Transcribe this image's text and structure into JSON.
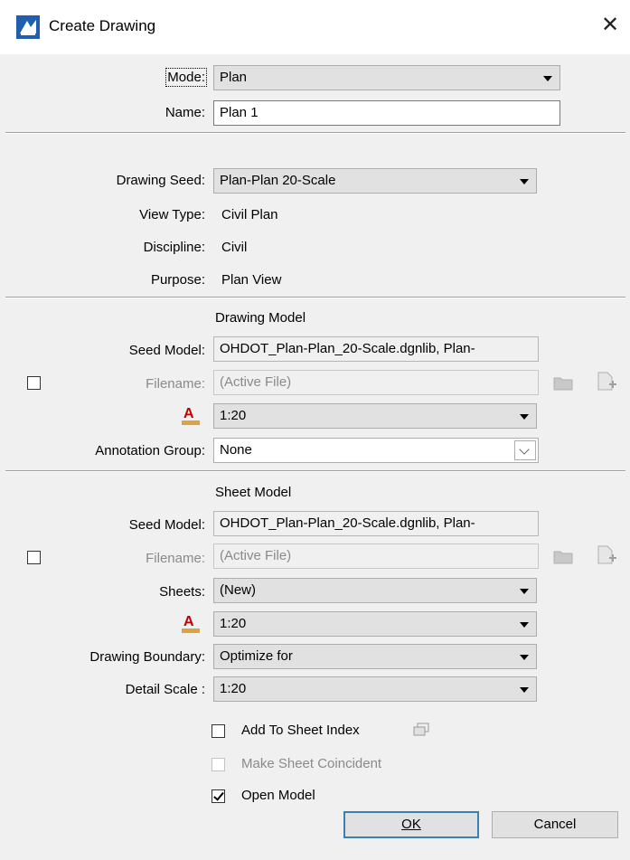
{
  "window": {
    "title": "Create Drawing",
    "close_glyph": "✕",
    "title_icon": "drawing-icon"
  },
  "mode": {
    "label": "Mode:",
    "value": "Plan"
  },
  "name": {
    "label": "Name:",
    "value": "Plan 1"
  },
  "seed": {
    "label": "Drawing Seed:",
    "value": "Plan-Plan 20-Scale",
    "view_type_label": "View Type:",
    "view_type": "Civil Plan",
    "discipline_label": "Discipline:",
    "discipline": "Civil",
    "purpose_label": "Purpose:",
    "purpose": "Plan View"
  },
  "drawing_model": {
    "heading": "Drawing Model",
    "seed_label": "Seed Model:",
    "seed_value": "OHDOT_Plan-Plan_20-Scale.dgnlib, Plan-",
    "filename_label": "Filename:",
    "filename_value": "(Active File)",
    "scale_value": "1:20",
    "annotation_label": "Annotation Group:",
    "annotation_value": "None",
    "checked": false
  },
  "sheet_model": {
    "heading": "Sheet Model",
    "seed_label": "Seed Model:",
    "seed_value": "OHDOT_Plan-Plan_20-Scale.dgnlib, Plan-",
    "filename_label": "Filename:",
    "filename_value": "(Active File)",
    "sheets_label": "Sheets:",
    "sheets_value": "(New)",
    "scale_value": "1:20",
    "boundary_label": "Drawing Boundary:",
    "boundary_value": "Optimize for",
    "detail_label": "Detail Scale :",
    "detail_value": "1:20",
    "checked": false
  },
  "options": {
    "add_to_index": "Add To Sheet Index",
    "make_coincident": "Make Sheet Coincident",
    "open_model": "Open Model",
    "add_to_index_checked": false,
    "make_coincident_checked": false,
    "open_model_checked": true
  },
  "buttons": {
    "ok": "OK",
    "cancel": "Cancel"
  },
  "colors": {
    "annotation_icon": "#c00000",
    "default_button_border": "#3c7fb1"
  }
}
